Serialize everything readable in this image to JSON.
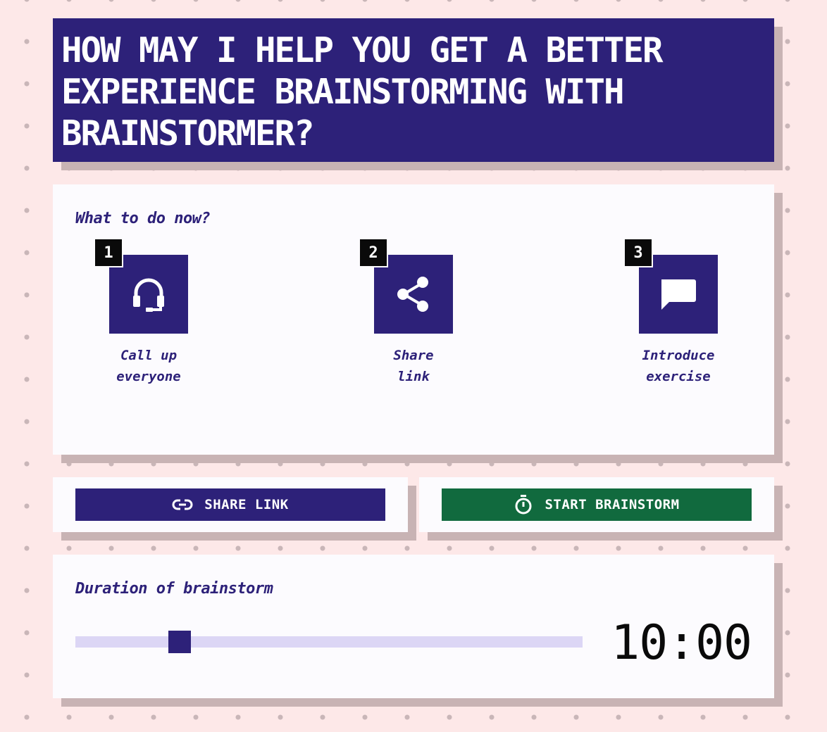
{
  "header": {
    "title": "HOW MAY I HELP YOU GET A BETTER EXPERIENCE BRAINSTORMING WITH BRAINSTORMER?"
  },
  "steps": {
    "heading": "What to do now?",
    "items": [
      {
        "number": "1",
        "label": "Call up\neveryone",
        "icon": "headset-icon"
      },
      {
        "number": "2",
        "label": "Share\nlink",
        "icon": "share-icon"
      },
      {
        "number": "3",
        "label": "Introduce\nexercise",
        "icon": "chat-bubble-icon"
      }
    ]
  },
  "actions": {
    "share_label": "SHARE LINK",
    "share_icon": "link-icon",
    "start_label": "START BRAINSTORM",
    "start_icon": "stopwatch-icon"
  },
  "duration": {
    "heading": "Duration of brainstorm",
    "value_label": "10:00",
    "slider_fraction": 0.205
  },
  "colors": {
    "background": "#fde8e8",
    "primary": "#2d2179",
    "start_button": "#116a3e",
    "panel": "#fcfbfe",
    "shadow": "#c8b3b4",
    "slider_track": "#dcd6f5"
  }
}
